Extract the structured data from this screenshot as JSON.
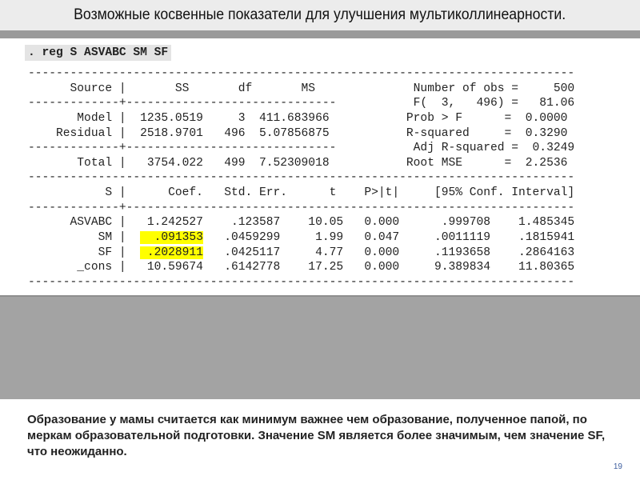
{
  "title": "Возможные косвенные показатели для улучшения мультиколлинеарности.",
  "command": ". reg S ASVABC SM SF",
  "output_lines": [
    "------------------------------------------------------------------------------",
    "      Source |       SS       df       MS              Number of obs =     500",
    "-------------+------------------------------           F(  3,   496) =   81.06",
    "       Model |  1235.0519     3  411.683966           Prob > F      =  0.0000",
    "    Residual |  2518.9701   496  5.07856875           R-squared     =  0.3290",
    "-------------+------------------------------           Adj R-squared =  0.3249",
    "       Total |   3754.022   499  7.52309018           Root MSE      =  2.2536",
    "------------------------------------------------------------------------------",
    "           S |      Coef.   Std. Err.      t    P>|t|     [95% Conf. Interval]",
    "-------------+----------------------------------------------------------------",
    "      ASVABC |   1.242527    .123587    10.05   0.000      .999708    1.485345"
  ],
  "highlighted_rows": [
    {
      "pre": "          SM |  ",
      "coef": "  .091353",
      "post": "   .0459299     1.99   0.047     .0011119    .1815941"
    },
    {
      "pre": "          SF |  ",
      "coef": " .2028911",
      "post": "   .0425117     4.77   0.000     .1193658    .2864163"
    }
  ],
  "tail_lines": [
    "       _cons |   10.59674   .6142778    17.25   0.000     9.389834    11.80365",
    "------------------------------------------------------------------------------"
  ],
  "note": "Образование у мамы считается как минимум важнее чем образование, полученное папой, по меркам образовательной подготовки. Значение SM является более значимым, чем значение SF, что неожиданно.",
  "page_number": "19",
  "colors": {
    "highlight": "#ffff00",
    "page_number": "#4060a0",
    "band": "#a3a3a3"
  }
}
